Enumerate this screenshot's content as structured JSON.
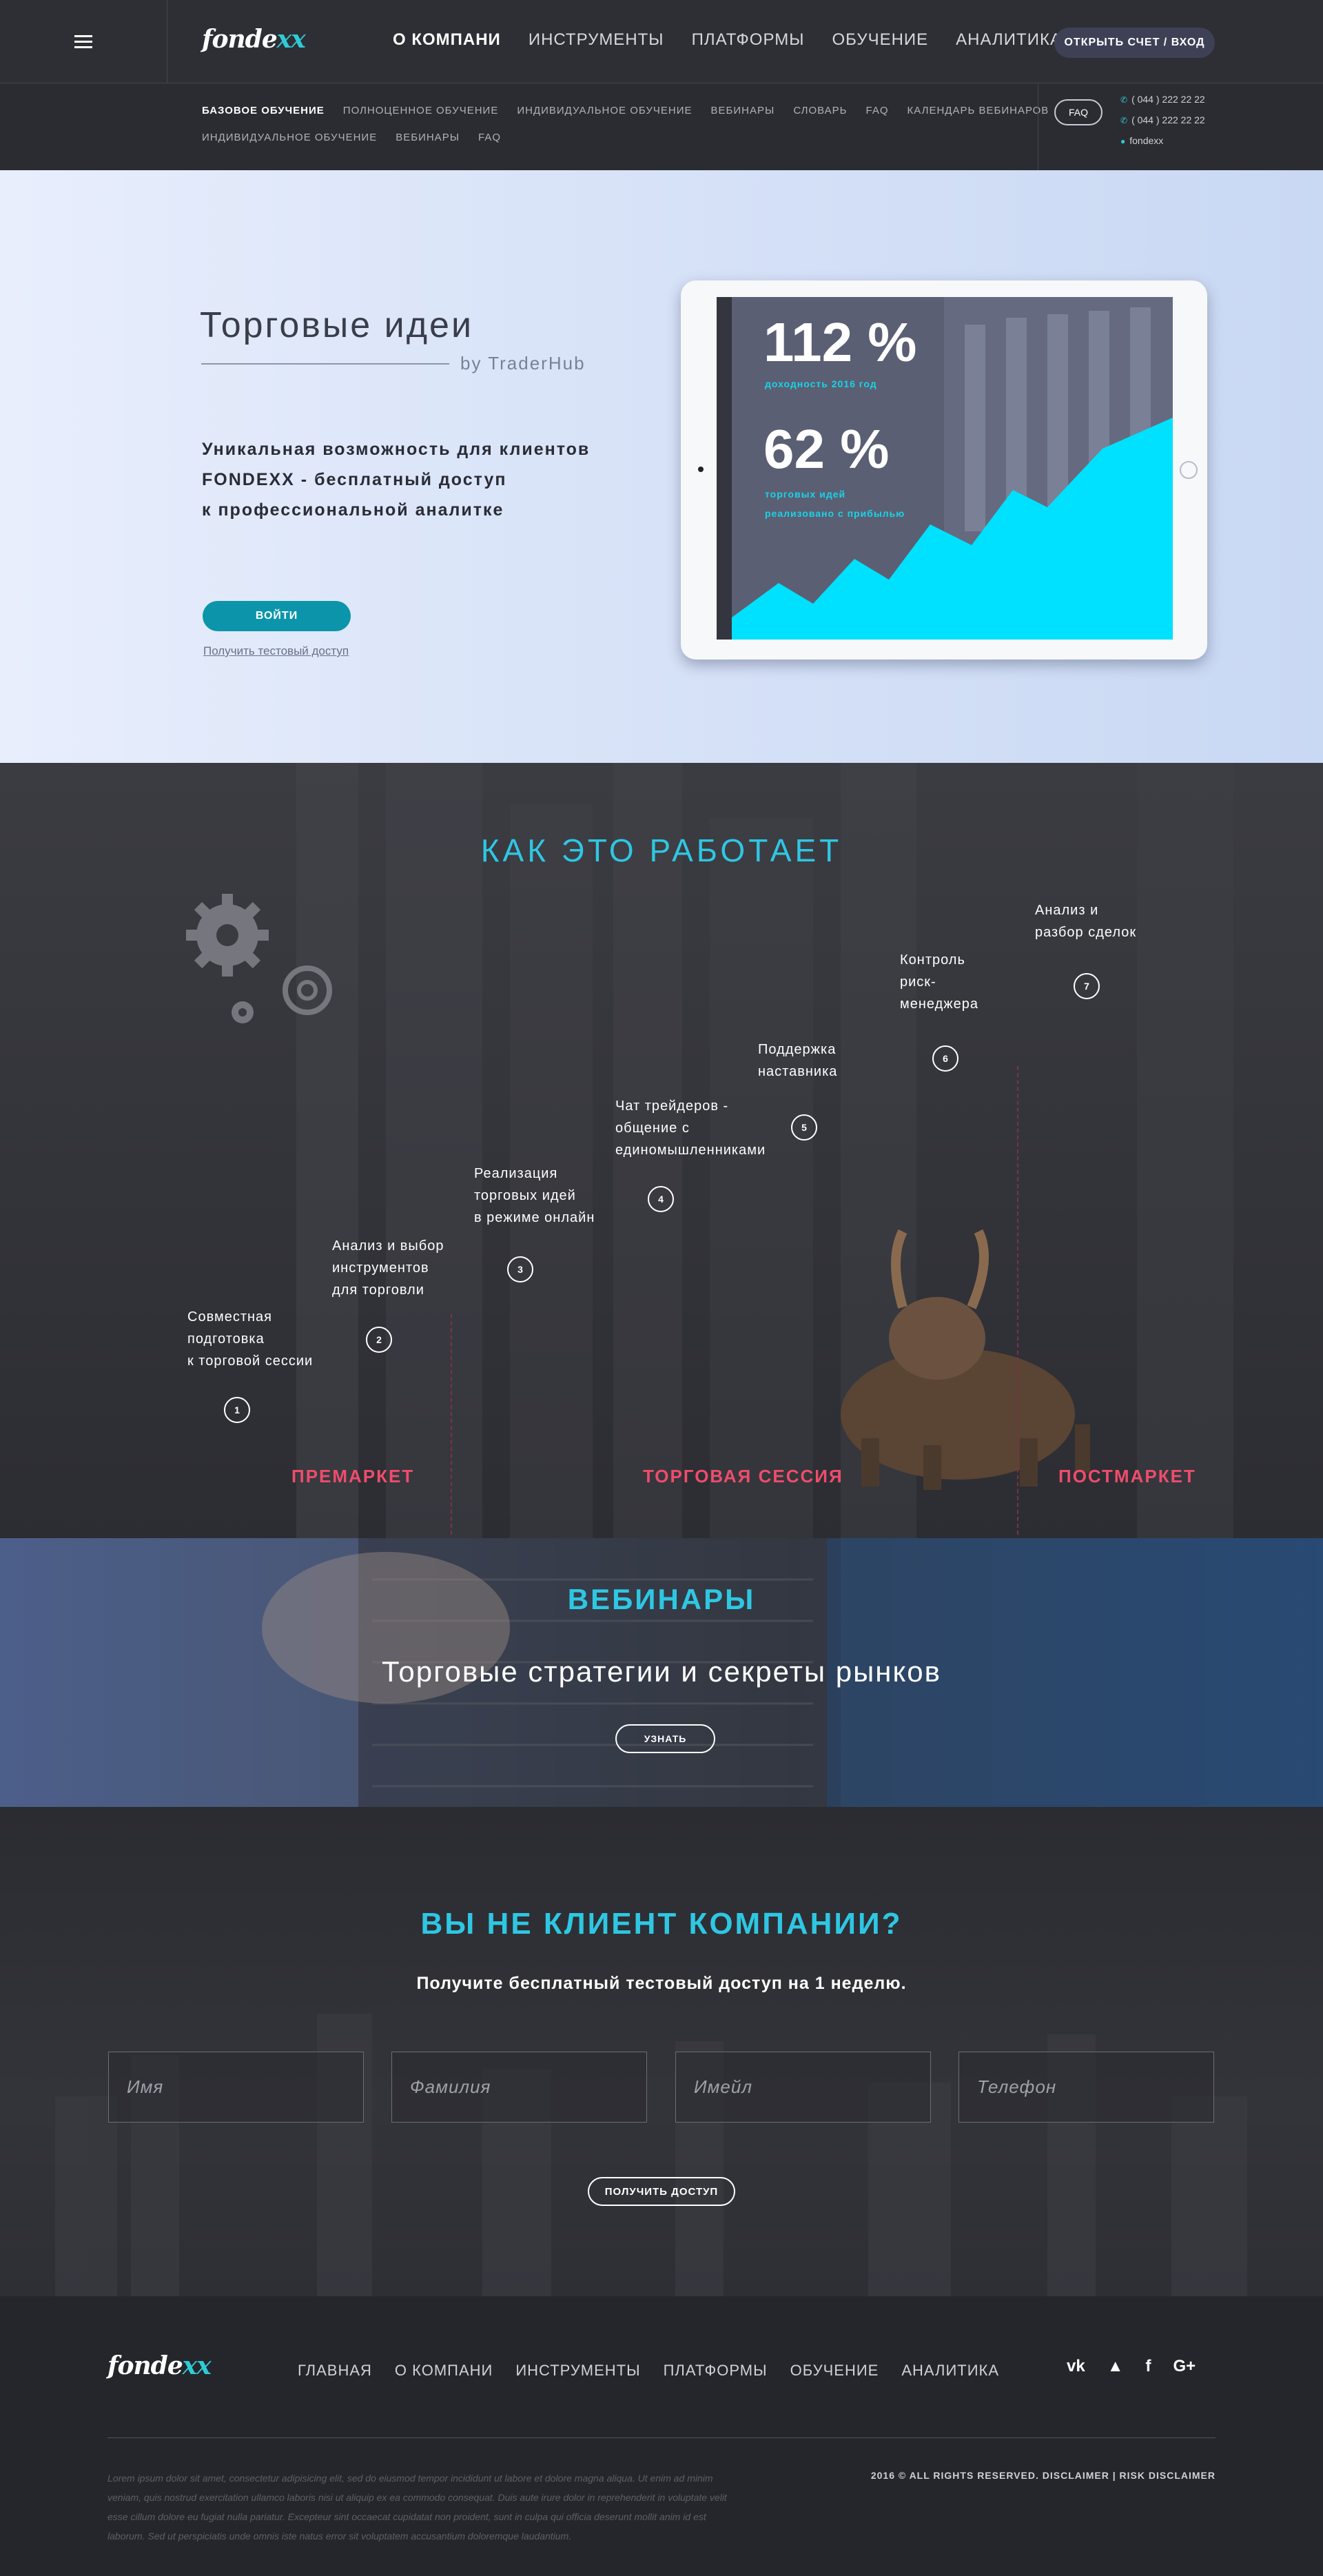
{
  "header": {
    "logo_main": "fonde",
    "logo_accent": "xx",
    "nav": [
      "О КОМПАНИ",
      "ИНСТРУМЕНТЫ",
      "ПЛАТФОРМЫ",
      "ОБУЧЕНИЕ",
      "АНАЛИТИКА"
    ],
    "account_button": "ОТКРЫТЬ СЧЕТ / ВХОД"
  },
  "subnav": {
    "row1": [
      "БАЗОВОЕ ОБУЧЕНИЕ",
      "ПОЛНОЦЕННОЕ ОБУЧЕНИЕ",
      "ИНДИВИДУАЛЬНОЕ ОБУЧЕНИЕ",
      "ВЕБИНАРЫ",
      "СЛОВАРЬ",
      "FAQ",
      "КАЛЕНДАРЬ ВЕБИНАРОВ"
    ],
    "row2": [
      "ИНДИВИДУАЛЬНОЕ ОБУЧЕНИЕ",
      "ВЕБИНАРЫ",
      "FAQ"
    ],
    "faq_button": "FAQ",
    "phone1": "( 044 ) 222 22 22",
    "phone2": "( 044 ) 222 22 22",
    "skype": "fondexx"
  },
  "hero": {
    "title": "Торговые идеи",
    "byline": "by TraderHub",
    "text_line1": "Уникальная возможность для клиентов",
    "text_line2": "FONDEXX - бесплатный доступ",
    "text_line3": "к профессиональной аналитке",
    "login_button": "ВОЙТИ",
    "trial_link": "Получить тестовый доступ",
    "stat1_value": "112 %",
    "stat1_caption": "доходность 2016 год",
    "stat2_value": "62 %",
    "stat2_caption_line1": "торговых идей",
    "stat2_caption_line2": "реализовано с прибылью",
    "area_color": "#00e0ff"
  },
  "how": {
    "title": "КАК ЭТО РАБОТАЕТ",
    "steps": [
      {
        "num": "1",
        "lines": [
          "Совместная",
          "подготовка",
          "к торговой сессии"
        ]
      },
      {
        "num": "2",
        "lines": [
          "Анализ и выбор",
          "инструментов",
          "для торговли"
        ]
      },
      {
        "num": "3",
        "lines": [
          "Реализация",
          "торговых идей",
          "в режиме онлайн"
        ]
      },
      {
        "num": "4",
        "lines": [
          "Чат трейдеров -",
          "общение с",
          "единомышленниками"
        ]
      },
      {
        "num": "5",
        "lines": [
          "Поддержка",
          "наставника"
        ]
      },
      {
        "num": "6",
        "lines": [
          "Контроль",
          "риск-",
          "менеджера"
        ]
      },
      {
        "num": "7",
        "lines": [
          "Анализ и",
          "разбор сделок"
        ]
      }
    ],
    "phases": [
      "ПРЕМАРКЕТ",
      "ТОРГОВАЯ СЕССИЯ",
      "ПОСТМАРКЕТ"
    ],
    "phase_color": "#ef4c6c"
  },
  "webinars": {
    "title": "ВЕБИНАРЫ",
    "subtitle": "Торговые стратегии и секреты рынков",
    "button": "УЗНАТЬ"
  },
  "lead": {
    "title": "ВЫ НЕ КЛИЕНТ КОМПАНИИ?",
    "subtitle": "Получите бесплатный тестовый доступ на 1 неделю.",
    "placeholders": [
      "Имя",
      "Фамилия",
      "Имейл",
      "Телефон"
    ],
    "button": "ПОЛУЧИТЬ ДОСТУП"
  },
  "footer": {
    "nav": [
      "ГЛАВНАЯ",
      "О КОМПАНИ",
      "ИНСТРУМЕНТЫ",
      "ПЛАТФОРМЫ",
      "ОБУЧЕНИЕ",
      "АНАЛИТИКА"
    ],
    "social": [
      "vk-icon",
      "twitter-icon",
      "facebook-icon",
      "google-plus-icon"
    ],
    "lorem": "Lorem ipsum dolor sit amet, consectetur adipisicing elit, sed do eiusmod tempor incididunt ut labore et dolore magna aliqua. Ut enim ad minim veniam, quis nostrud exercitation ullamco laboris nisi ut aliquip ex ea commodo consequat. Duis aute irure dolor in reprehenderit in voluptate velit esse cillum dolore eu fugiat nulla pariatur. Excepteur sint occaecat cupidatat non proident, sunt in culpa qui officia deserunt mollit anim id est laborum. Sed ut perspiciatis unde omnis iste natus error sit voluptatem accusantium doloremque laudantium.",
    "copyright": "2016 © ALL RIGHTS RESERVED. DISCLAIMER | RISK DISCLAIMER"
  },
  "colors": {
    "accent": "#2ec7e3",
    "brand_dark": "#2b2c31",
    "button_teal": "#0c95aa"
  }
}
